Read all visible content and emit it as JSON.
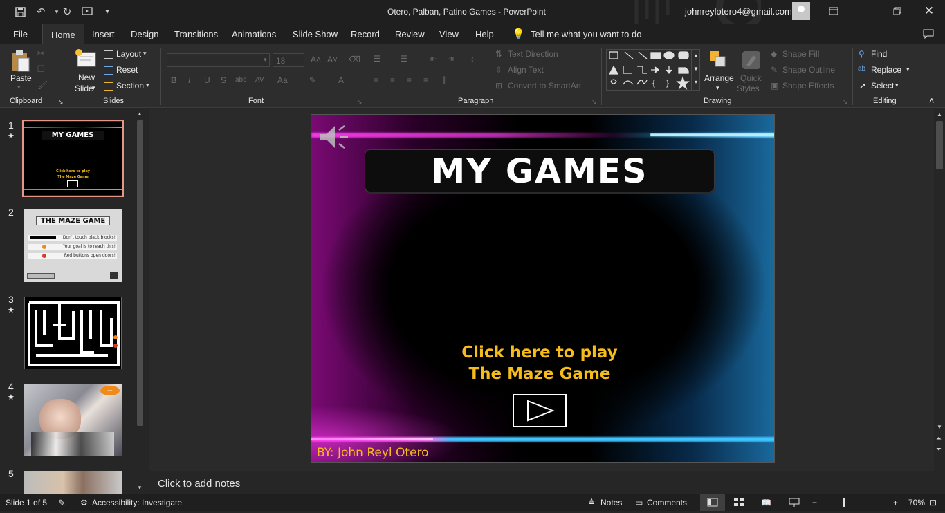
{
  "window": {
    "title": "Otero, Palban, Patino Games  -  PowerPoint",
    "account": "johnreylotero4@gmail.com"
  },
  "tabs": [
    "File",
    "Home",
    "Insert",
    "Design",
    "Transitions",
    "Animations",
    "Slide Show",
    "Record",
    "Review",
    "View",
    "Help"
  ],
  "tell_me": "Tell me what you want to do",
  "ribbon": {
    "clipboard": {
      "label": "Clipboard",
      "paste": "Paste"
    },
    "slides": {
      "label": "Slides",
      "new_slide_1": "New",
      "new_slide_2": "Slide",
      "layout": "Layout",
      "reset": "Reset",
      "section": "Section"
    },
    "font": {
      "label": "Font",
      "font_size": "18"
    },
    "paragraph": {
      "label": "Paragraph",
      "text_direction": "Text Direction",
      "align_text": "Align Text",
      "smartart": "Convert to SmartArt"
    },
    "drawing": {
      "label": "Drawing",
      "arrange": "Arrange",
      "quick_1": "Quick",
      "quick_2": "Styles",
      "shape_fill": "Shape Fill",
      "shape_outline": "Shape Outline",
      "shape_effects": "Shape Effects"
    },
    "editing": {
      "label": "Editing",
      "find": "Find",
      "replace": "Replace",
      "select": "Select"
    }
  },
  "thumbnails": [
    {
      "num": "1",
      "star": "★",
      "title": "MY GAMES",
      "sub1": "Click here to play",
      "sub2": "The Maze Game"
    },
    {
      "num": "2",
      "star": "",
      "title": "THE MAZE GAME",
      "rows": [
        "Don't touch black blocks!",
        "Your goal is to reach this!",
        "Red buttons open doors!"
      ]
    },
    {
      "num": "3",
      "star": "★"
    },
    {
      "num": "4",
      "star": "★",
      "bubble": "......"
    },
    {
      "num": "5",
      "star": ""
    }
  ],
  "slide": {
    "title": "MY GAMES",
    "line1": "Click here to play",
    "line2": "The Maze Game",
    "byline": "BY: John Reyl Otero"
  },
  "notes_placeholder": "Click to add notes",
  "status": {
    "slide_of": "Slide 1 of 5",
    "accessibility": "Accessibility: Investigate",
    "notes": "Notes",
    "comments": "Comments",
    "zoom": "70%"
  },
  "colors": {
    "accent_pink": "#ff3df0",
    "accent_cyan": "#3fc4ff",
    "gold": "#f6bd1a"
  }
}
